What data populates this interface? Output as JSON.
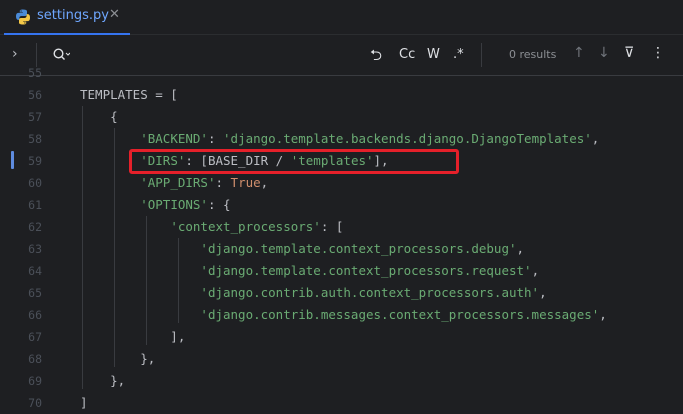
{
  "tab": {
    "filename": "settings.py",
    "close": "✕"
  },
  "find": {
    "expand": "›",
    "search_icon_label": "Q",
    "opt_regex_replace": "⮌",
    "opt_case": "Cc",
    "opt_word": "W",
    "opt_regex": ".*",
    "results": "0 results",
    "up": "↑",
    "down": "↓",
    "filter": "⊽",
    "more": "⋮"
  },
  "editor": {
    "partial_line_number": "55",
    "lines": [
      {
        "n": "56",
        "text": "TEMPLATES = ["
      },
      {
        "n": "57",
        "text": "    {"
      },
      {
        "n": "58",
        "text": "        'BACKEND': 'django.template.backends.django.DjangoTemplates',"
      },
      {
        "n": "59",
        "text": "        'DIRS': [BASE_DIR / 'templates'],"
      },
      {
        "n": "60",
        "text": "        'APP_DIRS': True,"
      },
      {
        "n": "61",
        "text": "        'OPTIONS': {"
      },
      {
        "n": "62",
        "text": "            'context_processors': ["
      },
      {
        "n": "63",
        "text": "                'django.template.context_processors.debug',"
      },
      {
        "n": "64",
        "text": "                'django.template.context_processors.request',"
      },
      {
        "n": "65",
        "text": "                'django.contrib.auth.context_processors.auth',"
      },
      {
        "n": "66",
        "text": "                'django.contrib.messages.context_processors.messages',"
      },
      {
        "n": "67",
        "text": "            ],"
      },
      {
        "n": "68",
        "text": "        },"
      },
      {
        "n": "69",
        "text": "    },"
      },
      {
        "n": "70",
        "text": "]"
      }
    ]
  }
}
